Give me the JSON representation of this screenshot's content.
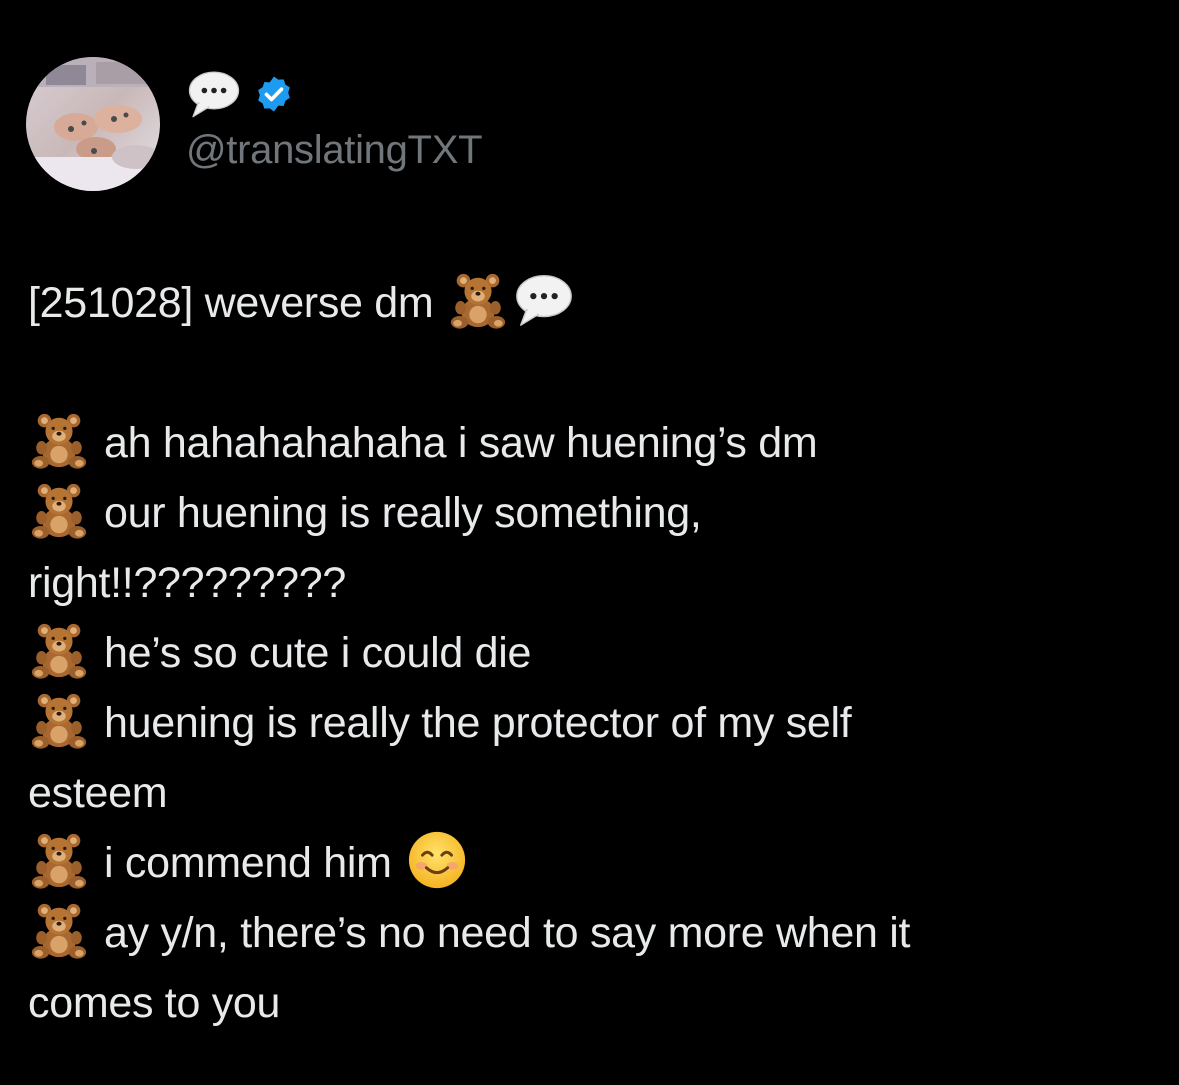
{
  "header": {
    "display_name_icon": "speech-bubble-icon",
    "verified_icon": "verified-badge-icon",
    "verified_color": "#1d9bf0",
    "handle": "@translatingTXT"
  },
  "tweet": {
    "title": "[251028] weverse dm",
    "title_icons": [
      "teddy-bear-icon",
      "speech-bubble-icon"
    ],
    "lines": [
      {
        "icon": "teddy-bear-icon",
        "text": "ah hahahahahaha i saw huening’s dm"
      },
      {
        "icon": "teddy-bear-icon",
        "text": "our huening is really something,"
      },
      {
        "icon": "",
        "text": "right!!?????????"
      },
      {
        "icon": "teddy-bear-icon",
        "text": "he’s so cute i could die"
      },
      {
        "icon": "teddy-bear-icon",
        "text": "huening is really the protector of my self"
      },
      {
        "icon": "",
        "text": "esteem"
      },
      {
        "icon": "teddy-bear-icon",
        "text": "i commend him",
        "trailing_icon": "smiling-face-icon"
      },
      {
        "icon": "teddy-bear-icon",
        "text": "ay y/n, there’s no need to say more when it"
      },
      {
        "icon": "",
        "text": "comes to you"
      }
    ]
  },
  "colors": {
    "background": "#000000",
    "text": "#e7e9ea",
    "secondary_text": "#71767b"
  }
}
